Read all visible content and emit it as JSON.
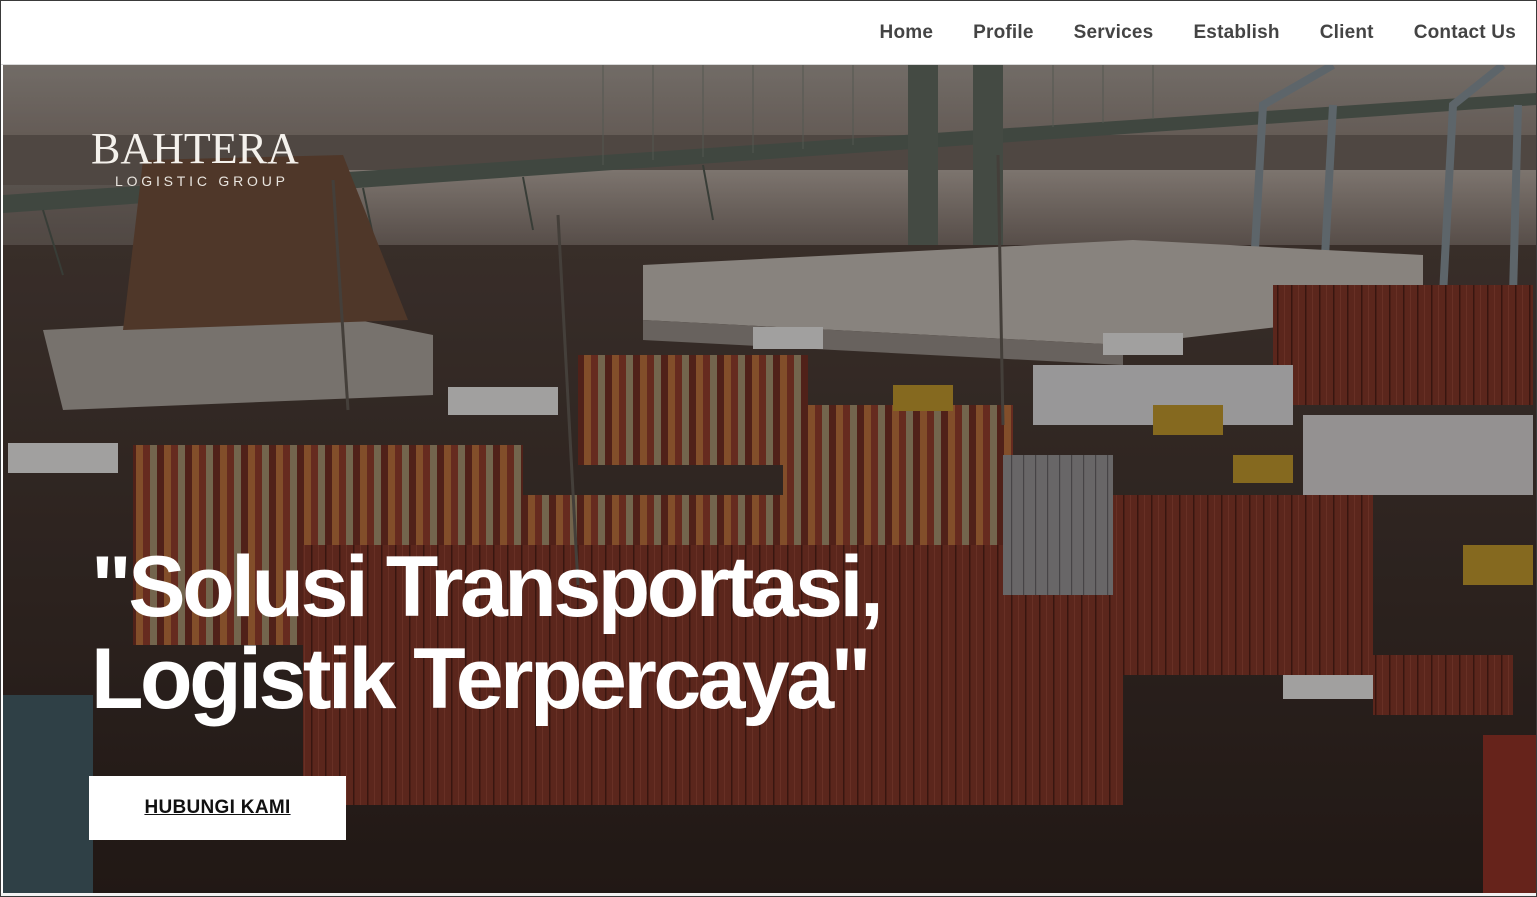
{
  "nav": {
    "items": [
      "Home",
      "Profile",
      "Services",
      "Establish",
      "Client",
      "Contact Us"
    ]
  },
  "logo": {
    "brand": "BAHTERA",
    "tagline": "LOGISTIC GROUP"
  },
  "hero": {
    "headline_line1": "\"Solusi Transportasi,",
    "headline_line2": "Logistik Terpercaya\"",
    "cta_label": "HUBUNGI KAMI",
    "background": "container-port-aerial-photo"
  },
  "colors": {
    "header_bg": "#ffffff",
    "nav_text": "#444444",
    "headline": "#ffffff",
    "cta_bg": "#ffffff",
    "cta_text": "#111111"
  }
}
